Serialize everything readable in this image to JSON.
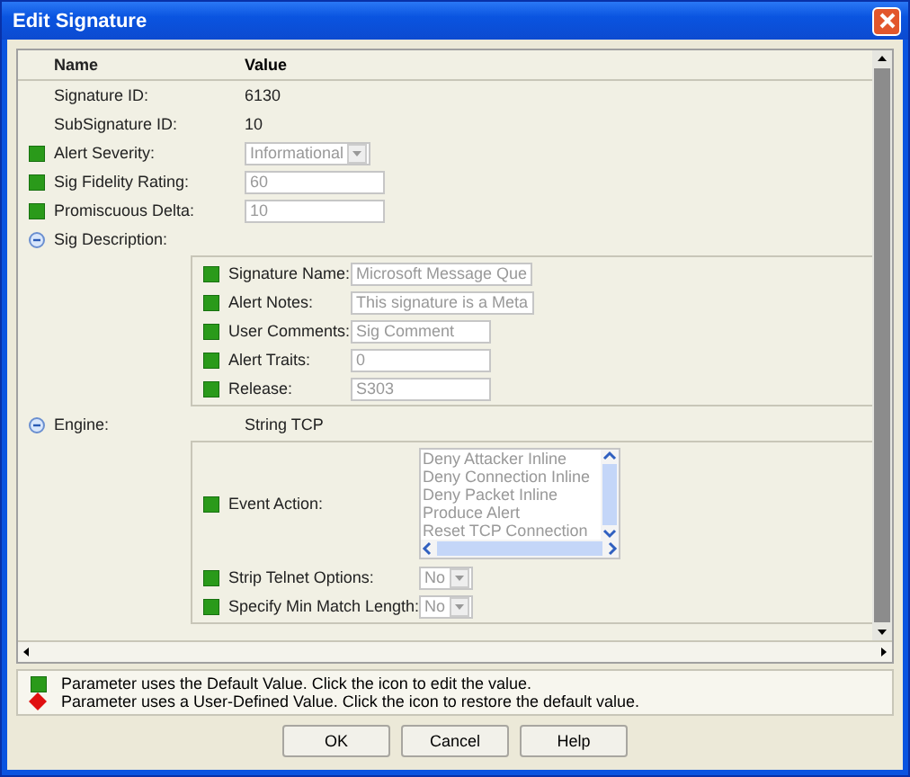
{
  "window": {
    "title": "Edit Signature"
  },
  "table": {
    "columns": [
      "Name",
      "Value"
    ],
    "rows": [
      {
        "kind": "text",
        "label": "Signature ID:",
        "value": "6130"
      },
      {
        "kind": "text",
        "label": "SubSignature ID:",
        "value": "10"
      },
      {
        "kind": "select",
        "label": "Alert Severity:",
        "value": "Informational",
        "user_defined": false
      },
      {
        "kind": "input",
        "label": "Sig Fidelity Rating:",
        "value": "60",
        "user_defined": false
      },
      {
        "kind": "input",
        "label": "Promiscuous Delta:",
        "value": "10",
        "user_defined": false
      },
      {
        "kind": "group",
        "label": "Sig Description:",
        "expanded": true,
        "children": [
          {
            "kind": "input",
            "label": "Signature Name:",
            "value": "Microsoft Message Que",
            "user_defined": false
          },
          {
            "kind": "input",
            "label": "Alert Notes:",
            "value": "This signature is a Meta",
            "user_defined": false
          },
          {
            "kind": "input",
            "label": "User Comments:",
            "value": "Sig Comment",
            "user_defined": false
          },
          {
            "kind": "input",
            "label": "Alert Traits:",
            "value": "0",
            "user_defined": false
          },
          {
            "kind": "input",
            "label": "Release:",
            "value": "S303",
            "user_defined": false
          }
        ]
      },
      {
        "kind": "group",
        "label": "Engine:",
        "value": "String TCP",
        "expanded": true,
        "children": [
          {
            "kind": "list",
            "label": "Event Action:",
            "items": [
              "Deny Attacker Inline",
              "Deny Connection Inline",
              "Deny Packet Inline",
              "Produce Alert",
              "Reset TCP Connection"
            ],
            "user_defined": false
          },
          {
            "kind": "select",
            "label": "Strip Telnet Options:",
            "value": "No",
            "user_defined": false
          },
          {
            "kind": "select",
            "label": "Specify Min Match Length:",
            "value": "No",
            "user_defined": false
          }
        ]
      }
    ]
  },
  "legend": [
    {
      "kind": "default",
      "text": "Parameter uses the Default Value. Click the icon to edit the value."
    },
    {
      "kind": "user",
      "text": "Parameter uses a User-Defined Value. Click the icon to restore the default value."
    }
  ],
  "buttons": [
    "OK",
    "Cancel",
    "Help"
  ]
}
